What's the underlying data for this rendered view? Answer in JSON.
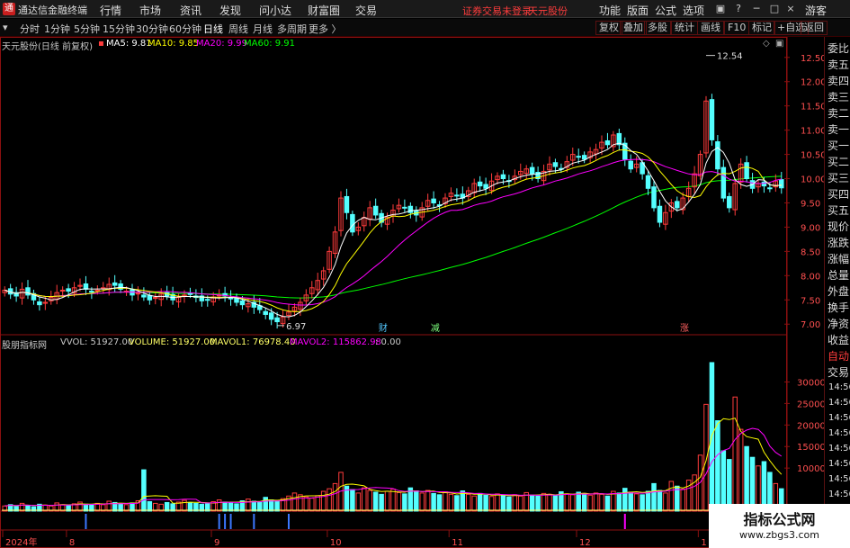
{
  "menubar": {
    "app_name": "通达信金融终端",
    "items": [
      "行情",
      "市场",
      "资讯",
      "发现",
      "问小达",
      "财富圈",
      "交易"
    ],
    "warn": "证券交易未登录",
    "stock": "天元股份",
    "right_items": [
      "功能",
      "版面",
      "公式",
      "选项"
    ],
    "guest": "游客"
  },
  "periodbar": {
    "periods": [
      "分时",
      "1分钟",
      "5分钟",
      "15分钟",
      "30分钟",
      "60分钟",
      "日线",
      "周线",
      "月线",
      "多周期",
      "更多 〉"
    ],
    "active_index": 6,
    "tools": [
      "复权",
      "叠加",
      "多股",
      "统计",
      "画线",
      "F10",
      "标记",
      "+自选",
      "返回"
    ]
  },
  "price_header": {
    "title": "天元股份(日线 前复权)",
    "ma5": "MA5: 9.81",
    "ma10": "MA10: 9.85",
    "ma20": "MA20: 9.99",
    "ma60": "MA60: 9.91"
  },
  "volume_header": {
    "title": "股朋指标网",
    "vvol": "VVOL: 51927.00",
    "volume": "VOLUME: 51927.00",
    "mavol1": "MAVOL1: 76978.40",
    "mavol2": "MAVOL2: 115862.98",
    "extra": ": 0.00"
  },
  "markers": {
    "high": "12.54",
    "low": "6.97",
    "tag1": "财",
    "tag2": "减",
    "tag3": "涨"
  },
  "sidepanel": {
    "items": [
      "委比",
      "卖五",
      "卖四",
      "卖三",
      "卖二",
      "卖一",
      "买一",
      "买二",
      "买三",
      "买四",
      "买五",
      "现价",
      "涨跌",
      "涨幅",
      "总量",
      "外盘",
      "换手",
      "净资",
      "收益",
      "自动",
      "交易"
    ],
    "times": [
      "14:56",
      "14:56",
      "14:56",
      "14:56",
      "14:56",
      "14:56",
      "14:56",
      "14:56"
    ]
  },
  "watermark": {
    "line1": "指标公式网",
    "line2": "www.zbgs3.com"
  },
  "colors": {
    "up": "#ff3c3c",
    "down": "#54ffff",
    "ma5": "#ffffff",
    "ma10": "#ffff00",
    "ma20": "#ff00ff",
    "ma60": "#00ff00",
    "grid_border": "#8b1010"
  },
  "chart_data": [
    {
      "type": "candlestick",
      "title": "天元股份(日线 前复权)",
      "y_ticks": [
        "12.50",
        "12.00",
        "11.50",
        "11.00",
        "10.50",
        "10.00",
        "9.50",
        "9.00",
        "8.50",
        "8.00",
        "7.50",
        "7.00"
      ],
      "ylim": [
        6.8,
        12.7
      ],
      "x_ticks": [
        "2024年",
        "8",
        "9",
        "10",
        "11",
        "12",
        "1"
      ],
      "high_marker": 12.54,
      "low_marker": 6.97,
      "closes": [
        7.7,
        7.62,
        7.58,
        7.72,
        7.6,
        7.5,
        7.4,
        7.45,
        7.55,
        7.65,
        7.7,
        7.68,
        7.75,
        7.8,
        7.72,
        7.66,
        7.7,
        7.75,
        7.82,
        7.8,
        7.72,
        7.68,
        7.6,
        7.64,
        7.56,
        7.5,
        7.55,
        7.62,
        7.58,
        7.5,
        7.55,
        7.6,
        7.62,
        7.55,
        7.48,
        7.5,
        7.56,
        7.6,
        7.58,
        7.52,
        7.45,
        7.4,
        7.42,
        7.35,
        7.3,
        7.2,
        7.1,
        7.05,
        7.15,
        7.25,
        7.35,
        7.45,
        7.6,
        7.75,
        7.9,
        8.1,
        8.5,
        8.9,
        9.6,
        9.3,
        8.9,
        9.0,
        9.2,
        9.4,
        9.25,
        9.1,
        9.2,
        9.35,
        9.45,
        9.4,
        9.3,
        9.25,
        9.4,
        9.55,
        9.5,
        9.45,
        9.6,
        9.7,
        9.65,
        9.6,
        9.75,
        9.9,
        9.85,
        9.8,
        9.95,
        10.05,
        10.0,
        9.95,
        10.05,
        10.15,
        10.2,
        10.1,
        10.0,
        10.15,
        10.3,
        10.25,
        10.2,
        10.35,
        10.5,
        10.45,
        10.4,
        10.55,
        10.6,
        10.75,
        10.7,
        10.9,
        10.7,
        10.4,
        10.2,
        10.3,
        10.1,
        9.8,
        9.4,
        9.1,
        9.3,
        9.5,
        9.4,
        9.6,
        9.8,
        10.1,
        10.5,
        11.6,
        10.8,
        10.2,
        9.6,
        9.4,
        9.9,
        10.3,
        10.0,
        9.8,
        9.9,
        9.85,
        9.8,
        9.95,
        9.81
      ],
      "series": [
        {
          "name": "MA5",
          "value": 9.81
        },
        {
          "name": "MA10",
          "value": 9.85
        },
        {
          "name": "MA20",
          "value": 9.99
        },
        {
          "name": "MA60",
          "value": 9.91
        }
      ]
    },
    {
      "type": "bar",
      "title": "股朋指标网",
      "y_ticks": [
        "30000",
        "25000",
        "20000",
        "15000",
        "10000"
      ],
      "ylim": [
        0,
        37000
      ],
      "values": [
        1200,
        1500,
        1100,
        1800,
        1300,
        1000,
        1600,
        1400,
        1200,
        1900,
        1500,
        1300,
        1700,
        2100,
        1600,
        1400,
        1800,
        1500,
        2300,
        2000,
        1700,
        1500,
        1900,
        2400,
        9600,
        2200,
        1800,
        1600,
        2000,
        1700,
        2100,
        2500,
        2000,
        1800,
        1600,
        1700,
        2200,
        2600,
        2100,
        1900,
        1700,
        2400,
        2800,
        2300,
        2000,
        3200,
        2600,
        2400,
        2900,
        3500,
        4200,
        3800,
        3300,
        3000,
        3600,
        4600,
        5200,
        6400,
        9000,
        5800,
        5000,
        4200,
        5400,
        4800,
        4400,
        3900,
        4600,
        5100,
        4300,
        4000,
        5400,
        4700,
        4200,
        4800,
        4100,
        3800,
        4500,
        3900,
        3600,
        4700,
        3900,
        3500,
        4100,
        3700,
        3400,
        4000,
        3600,
        3300,
        3800,
        3500,
        4300,
        3700,
        3500,
        4100,
        3900,
        3600,
        4500,
        4000,
        3800,
        4400,
        4100,
        3700,
        4200,
        3900,
        3500,
        4600,
        4200,
        5300,
        4400,
        4000,
        3800,
        4600,
        6400,
        4800,
        4200,
        6900,
        5800,
        5100,
        7200,
        8400,
        13000,
        24800,
        34500,
        21000,
        14000,
        12000,
        26500,
        19000,
        15000,
        12500,
        10500,
        11500,
        9000,
        6400,
        5200
      ]
    }
  ]
}
